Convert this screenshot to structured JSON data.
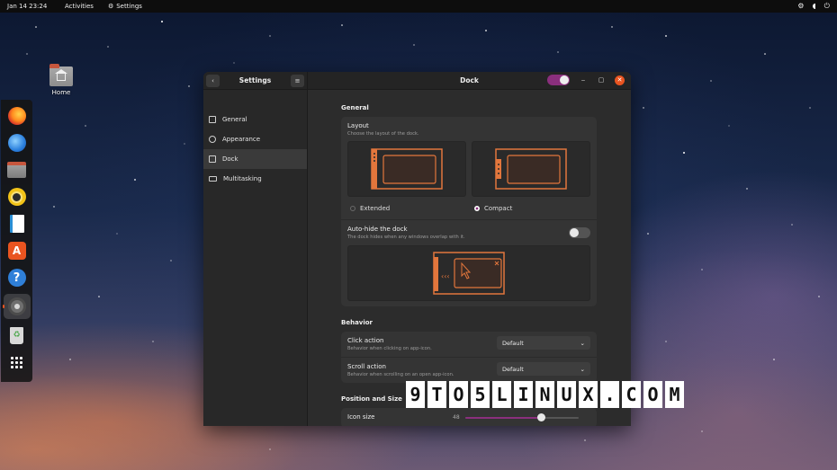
{
  "topbar": {
    "clock": "Jan 14  23:24",
    "activities": "Activities",
    "app_menu": "Settings",
    "app_menu_icon": "gear-icon",
    "tray_icons": [
      "network-icon",
      "volume-icon",
      "power-icon"
    ]
  },
  "desktop": {
    "home_label": "Home"
  },
  "dock": {
    "apps": [
      "Firefox",
      "Thunderbird",
      "Files",
      "Rhythmbox",
      "LibreOffice Writer",
      "Ubuntu Software",
      "Help",
      "Settings",
      "Trash",
      "Show Applications"
    ],
    "active_app": "Settings"
  },
  "window": {
    "sidebar_title": "Settings",
    "page_title": "Dock",
    "dock_enabled": true,
    "sidebar_items": [
      {
        "label": "General",
        "icon": "general-icon"
      },
      {
        "label": "Appearance",
        "icon": "appearance-icon"
      },
      {
        "label": "Dock",
        "icon": "dock-icon",
        "active": true
      },
      {
        "label": "Multitasking",
        "icon": "multitasking-icon"
      }
    ]
  },
  "content": {
    "general_heading": "General",
    "layout": {
      "title": "Layout",
      "subtitle": "Choose the layout of the dock.",
      "options": [
        "Extended",
        "Compact"
      ],
      "selected": "Compact"
    },
    "autohide": {
      "title": "Auto-hide the dock",
      "subtitle": "The dock hides when any windows overlap with it.",
      "enabled": false,
      "preview_arrows": "‹‹‹"
    },
    "behavior_heading": "Behavior",
    "click_action": {
      "title": "Click action",
      "subtitle": "Behavior when clicking on app-icon.",
      "value": "Default"
    },
    "scroll_action": {
      "title": "Scroll action",
      "subtitle": "Behavior when scrolling on an open app-icon.",
      "value": "Default"
    },
    "position_heading": "Position and Size",
    "icon_size": {
      "title": "Icon size",
      "value": "48",
      "fraction": 0.67
    }
  },
  "watermark": "9TO5LINUX.COM",
  "colors": {
    "accent": "#8a2f7d",
    "orange": "#e95420",
    "window_bg": "#2c2c2c"
  }
}
